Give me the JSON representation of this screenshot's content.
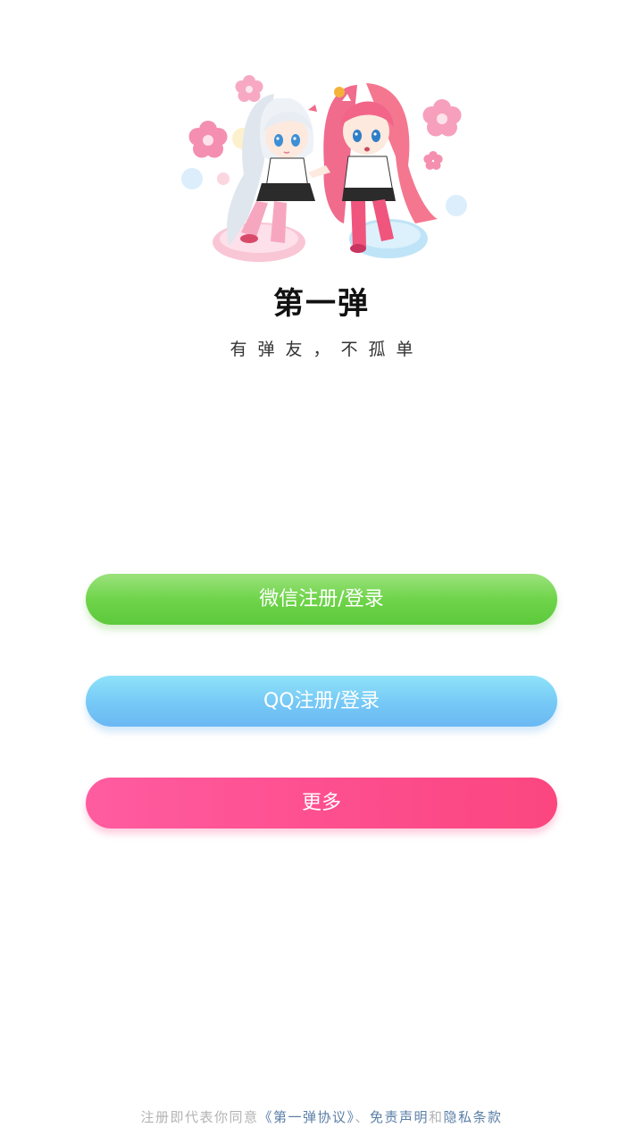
{
  "app": {
    "title": "第一弹",
    "slogan": "有弹友，不孤单"
  },
  "login": {
    "wechat_label": "微信注册/登录",
    "qq_label": "QQ注册/登录",
    "more_label": "更多"
  },
  "footer": {
    "prefix": "注册即代表你同意",
    "agreement_link": "《第一弹协议》",
    "separator": "、",
    "disclaimer_link": "免责声明",
    "and": "和",
    "privacy_link": "隐私条款"
  },
  "colors": {
    "wechat": "#6fd44a",
    "qq": "#75c8f6",
    "more": "#fd4d8c",
    "link": "#5b7fa6"
  },
  "icons": {
    "mascot": "anime-girls-illustration"
  }
}
